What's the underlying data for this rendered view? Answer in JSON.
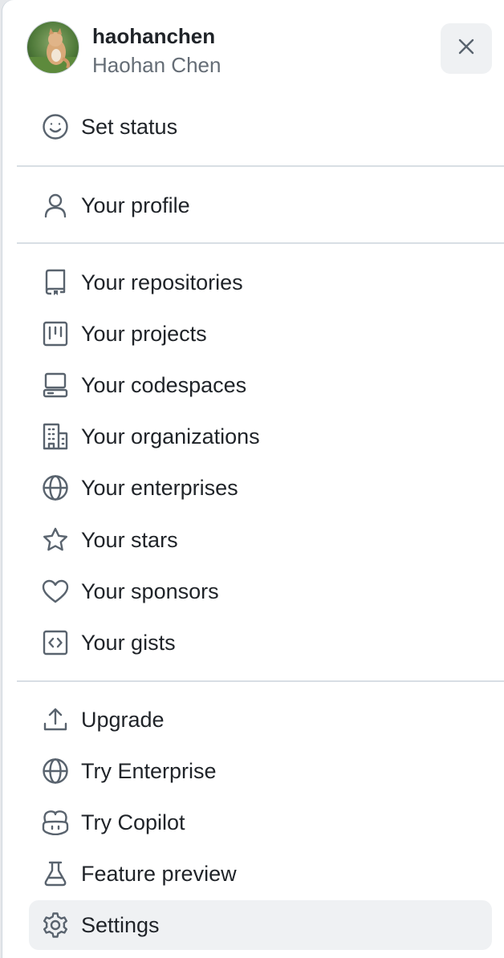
{
  "user": {
    "username": "haohanchen",
    "full_name": "Haohan Chen",
    "avatar_icon": "avatar-cat-photo"
  },
  "close_icon": "close-icon",
  "menu": {
    "set_status": {
      "label": "Set status",
      "icon": "smiley-icon"
    },
    "profile": {
      "label": "Your profile",
      "icon": "person-icon"
    },
    "repositories": {
      "label": "Your repositories",
      "icon": "repo-icon"
    },
    "projects": {
      "label": "Your projects",
      "icon": "project-icon"
    },
    "codespaces": {
      "label": "Your codespaces",
      "icon": "codespaces-icon"
    },
    "organizations": {
      "label": "Your organizations",
      "icon": "organization-icon"
    },
    "enterprises": {
      "label": "Your enterprises",
      "icon": "globe-icon"
    },
    "stars": {
      "label": "Your stars",
      "icon": "star-icon"
    },
    "sponsors": {
      "label": "Your sponsors",
      "icon": "heart-icon"
    },
    "gists": {
      "label": "Your gists",
      "icon": "code-square-icon"
    },
    "upgrade": {
      "label": "Upgrade",
      "icon": "upload-icon"
    },
    "try_enterprise": {
      "label": "Try Enterprise",
      "icon": "globe-icon"
    },
    "try_copilot": {
      "label": "Try Copilot",
      "icon": "copilot-icon"
    },
    "feature_preview": {
      "label": "Feature preview",
      "icon": "beaker-icon"
    },
    "settings": {
      "label": "Settings",
      "icon": "gear-icon",
      "active": true
    }
  },
  "colors": {
    "text_primary": "#1f2328",
    "text_secondary": "#656d76",
    "icon": "#59636e",
    "divider": "#d8dee4",
    "active_bg": "#eff1f3"
  }
}
